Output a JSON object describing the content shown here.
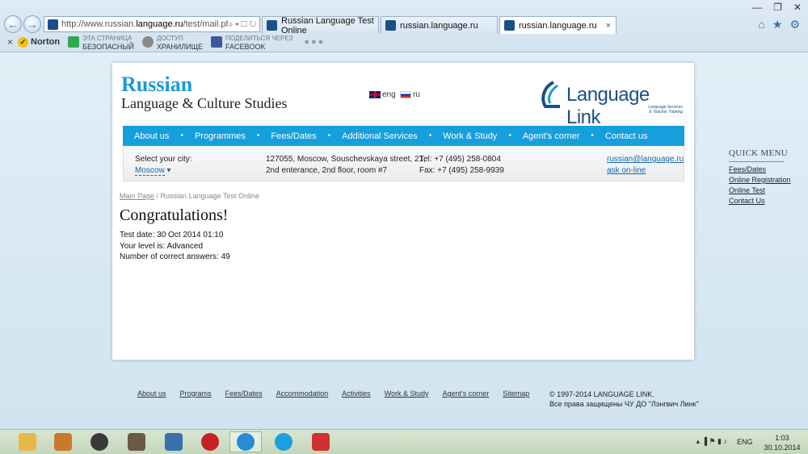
{
  "browser": {
    "url_prefix": "http://www.russian.",
    "url_domain": "language.ru",
    "url_path": "/test/mail.php",
    "addr_tools": "⌕ ▾ ☐ ↻",
    "tabs": [
      {
        "title": "Russian Language Test Online",
        "active": false
      },
      {
        "title": "russian.language.ru",
        "active": false
      },
      {
        "title": "russian.language.ru",
        "active": true
      }
    ],
    "tab_close": "×",
    "window_buttons": [
      "—",
      "❐",
      "✕"
    ],
    "right_tools": [
      "⌂",
      "★",
      "⚙"
    ]
  },
  "toolbar": {
    "close": "×",
    "norton": "Norton",
    "norton_check": "✓",
    "items": [
      {
        "line1": "ЭТА СТРАНИЦА",
        "line2": "БЕЗОПАСНЫЙ",
        "color": "#2fa84f"
      },
      {
        "line1": "ДОСТУП",
        "line2": "ХРАНИЛИЩЕ",
        "color": "#8a8a8a"
      },
      {
        "line1": "ПОДЕЛИТЬСЯ ЧЕРЕЗ",
        "line2": "FACEBOOK",
        "color": "#3b5998"
      }
    ],
    "more": "●●●"
  },
  "site": {
    "logo_line1": "Russian",
    "logo_line2": "Language & Culture Studies",
    "lang_eng": "eng",
    "lang_ru": "ru",
    "brand_name": "Language Link",
    "brand_sub1": "Language Services",
    "brand_sub2": "& Teacher Training",
    "brand_color": "#1d4f86",
    "menu": [
      "About us",
      "Programmes",
      "Fees/Dates",
      "Additional Services",
      "Work & Study",
      "Agent's corner",
      "Contact us"
    ],
    "menu_dot": "•",
    "menu_color": "#159fdc",
    "info": {
      "city_label": "Select your city:",
      "city_value": "Moscow",
      "city_caret": "▾",
      "address1": "127055, Moscow, Souschevskaya street, 21,",
      "address2": "2nd enterance, 2nd floor, room #7",
      "tel": "Tel: +7 (495) 258-0804",
      "fax": "Fax: +7 (495) 258-9939",
      "email": "russian@language.ru",
      "ask": "ask on-line"
    },
    "breadcrumb": {
      "home": "Main Page",
      "sep": " / ",
      "current": "Russian Language Test Online"
    },
    "heading": "Congratulations!",
    "results": {
      "date": "Test date: 30 Oct 2014 01:10",
      "level": "Your level is: Advanced",
      "correct": "Number of correct answers: 49"
    },
    "quick_menu": {
      "title": "QUICK MENU",
      "links": [
        "Fees/Dates",
        "Online Registration",
        "Online Test",
        "Contact Us"
      ]
    },
    "footer_links": [
      "About us",
      "Programs",
      "Fees/Dates",
      "Accommodation",
      "Activities",
      "Work & Study",
      "Agent's corner",
      "Sitemap"
    ],
    "copyright1": "© 1997-2014 LANGUAGE LINK.",
    "copyright2": "Все права защищены ЧУ ДО \"Лэнгвич Линк\""
  },
  "taskbar": {
    "apps": [
      {
        "name": "file-explorer",
        "color": "#e8b64a",
        "active": false
      },
      {
        "name": "app-2",
        "color": "#c9782c",
        "active": false
      },
      {
        "name": "app-3",
        "color": "#3a3a3a",
        "active": false
      },
      {
        "name": "app-4",
        "color": "#6c5a44",
        "active": false
      },
      {
        "name": "app-5",
        "color": "#3a6fb0",
        "active": false
      },
      {
        "name": "app-6",
        "color": "#c62020",
        "active": false
      },
      {
        "name": "internet-explorer",
        "color": "#2a8ad6",
        "active": true
      },
      {
        "name": "skype",
        "color": "#1ea0e0",
        "active": false
      },
      {
        "name": "app-9",
        "color": "#d03030",
        "active": false
      }
    ],
    "tray": "▴  ▐  ⚑  ▮  ♪",
    "language": "ENG",
    "time": "1:03",
    "date": "30.10.2014"
  }
}
